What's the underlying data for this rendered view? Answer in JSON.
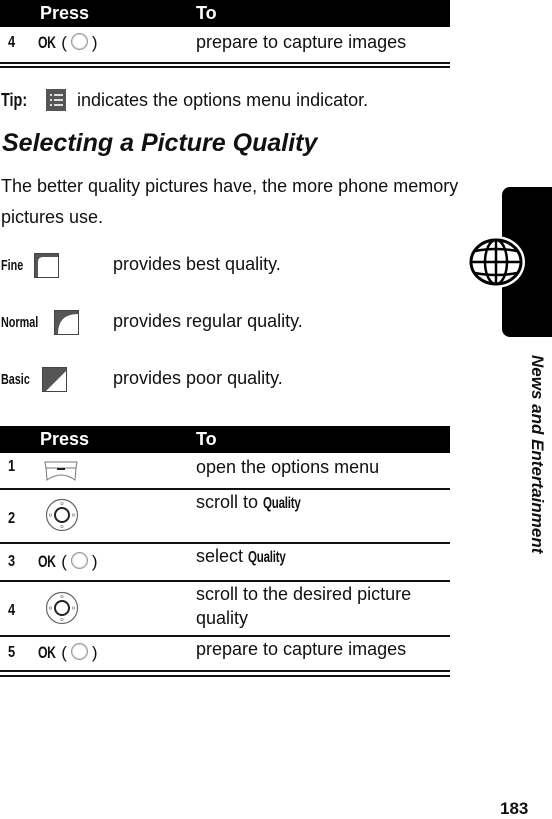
{
  "table1": {
    "headers": [
      "Press",
      "To"
    ],
    "rows": [
      {
        "step": "4",
        "press_key": "OK",
        "press_icon": "center-select-button-icon",
        "to": "prepare to capture images"
      }
    ]
  },
  "tip": {
    "label": "Tip:",
    "icon": "options-menu-indicator-icon",
    "text": "indicates the options menu indicator."
  },
  "section": {
    "title": "Selecting a Picture Quality",
    "body": "The better quality pictures have, the more phone memory pictures use."
  },
  "quality_options": [
    {
      "name": "Fine",
      "icon": "fine-quality-icon",
      "description": "provides best quality."
    },
    {
      "name": "Normal",
      "icon": "normal-quality-icon",
      "description": "provides regular quality."
    },
    {
      "name": "Basic",
      "icon": "basic-quality-icon",
      "description": "provides poor quality."
    }
  ],
  "table2": {
    "headers": [
      "Press",
      "To"
    ],
    "rows": [
      {
        "step": "1",
        "press_icon": "menu-key-icon",
        "to_prefix": "open the options menu",
        "to_keyword": ""
      },
      {
        "step": "2",
        "press_icon": "navigation-key-icon",
        "to_prefix": "scroll to",
        "to_keyword": "Quality"
      },
      {
        "step": "3",
        "press_key": "OK",
        "press_icon": "center-select-button-icon",
        "to_prefix": "select",
        "to_keyword": "Quality"
      },
      {
        "step": "4",
        "press_icon": "navigation-key-icon",
        "to_prefix": "scroll to the desired picture quality",
        "to_keyword": ""
      },
      {
        "step": "5",
        "press_key": "OK",
        "press_icon": "center-select-button-icon",
        "to_prefix": "prepare to capture images",
        "to_keyword": ""
      }
    ]
  },
  "side_tab": {
    "icon": "globe-icon",
    "chapter": "News and Entertainment"
  },
  "page_number": "183"
}
